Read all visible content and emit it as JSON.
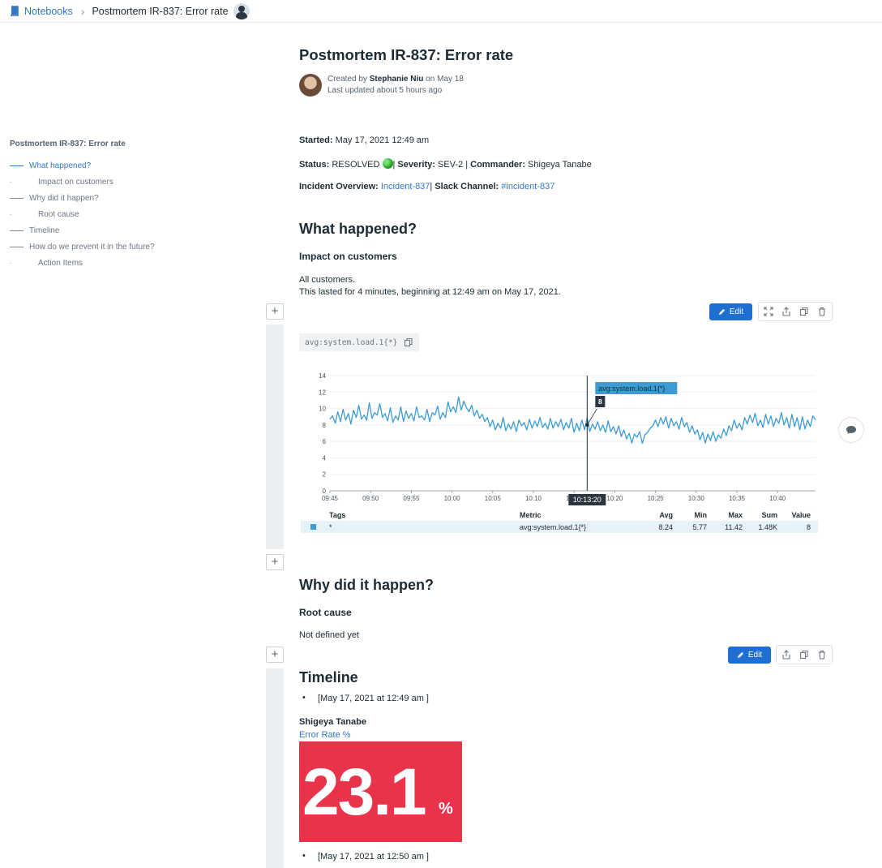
{
  "breadcrumb": {
    "root": "Notebooks",
    "current": "Postmortem IR-837: Error rate"
  },
  "toc": {
    "title": "Postmortem IR-837: Error rate",
    "items": [
      {
        "label": "What happened?"
      },
      {
        "label": "Impact on customers"
      },
      {
        "label": "Why did it happen?"
      },
      {
        "label": "Root cause"
      },
      {
        "label": "Timeline"
      },
      {
        "label": "How do we prevent it in the future?"
      },
      {
        "label": "Action Items"
      }
    ]
  },
  "doc": {
    "title": "Postmortem IR-837: Error rate",
    "created_prefix": "Created by",
    "author": "Stephanie Niu",
    "created_suffix": "on May 18",
    "updated": "Last updated about 5 hours ago"
  },
  "meta": {
    "started_label": "Started:",
    "started_value": "May 17, 2021 12:49 am",
    "status_label": "Status:",
    "status_value": "RESOLVED",
    "severity_label": "Severity:",
    "severity_value": "SEV-2",
    "commander_label": "Commander:",
    "commander_value": "Shigeya Tanabe",
    "overview_label": "Incident Overview:",
    "overview_link": "Incident-837",
    "slack_label": "Slack Channel:",
    "slack_link": "#incident-837",
    "separator": "|"
  },
  "sections": {
    "what_happened": "What happened?",
    "impact": "Impact on customers",
    "impact_line1": "All customers.",
    "impact_line2": "This lasted for 4 minutes, beginning at 12:49 am on May 17, 2021.",
    "why": "Why did it happen?",
    "root_cause": "Root cause",
    "root_cause_text": "Not defined yet",
    "timeline": "Timeline",
    "timeline_1": "[May 17, 2021 at 12:49 am ]",
    "timeline_author": "Shigeya Tanabe",
    "timeline_2": "[May 17, 2021 at 12:50 am ]"
  },
  "cell_actions": {
    "edit": "Edit"
  },
  "query": "avg:system.load.1{*}",
  "chart_data": {
    "type": "line",
    "series": [
      {
        "name": "avg:system.load.1{*}",
        "color": "#3d9bd4",
        "values": [
          8.7,
          9.1,
          8.2,
          9.6,
          8.4,
          9.9,
          8.6,
          9.4,
          8.1,
          9.8,
          8.9,
          10.4,
          8.7,
          9.2,
          8.6,
          10.7,
          8.8,
          9.5,
          9.2,
          10.6,
          8.9,
          9.4,
          8.5,
          10.1,
          8.3,
          9.1,
          8.6,
          10.2,
          8.4,
          9.7,
          8.8,
          9.4,
          8.5,
          10.2,
          8.9,
          9.1,
          8.6,
          9.9,
          8.4,
          9.5,
          9.2,
          10.3,
          8.7,
          9.5,
          8.9,
          10.8,
          9.6,
          10.2,
          9.5,
          11.4,
          9.8,
          10.9,
          10.1,
          9.6,
          10.4,
          9.1,
          9.8,
          8.8,
          9.3,
          8.4,
          8.9,
          7.8,
          8.6,
          7.4,
          8.2,
          7.6,
          8.9,
          7.3,
          8.1,
          7.5,
          8.4,
          7.2,
          8.6,
          7.9,
          8.3,
          7.4,
          8.7,
          7.6,
          8.5,
          7.8,
          8.9,
          7.7,
          8.2,
          7.5,
          8.8,
          7.6,
          8.4,
          7.8,
          8.7,
          7.4,
          8.3,
          7.6,
          8.8,
          7.1,
          8.2,
          7.3,
          8.6,
          7.4,
          8.9,
          7.2,
          8.1,
          7.5,
          8.4,
          7.3,
          8.0,
          7.1,
          8.5,
          7.2,
          7.8,
          6.9,
          7.9,
          6.6,
          7.4,
          6.3,
          7.0,
          5.8,
          6.9,
          6.5,
          7.2,
          5.77,
          6.8,
          7.1,
          7.6,
          7.9,
          8.6,
          7.8,
          8.9,
          8.1,
          9.0,
          7.6,
          8.8,
          7.9,
          8.4,
          7.5,
          8.9,
          7.8,
          8.3,
          7.1,
          7.9,
          6.9,
          7.4,
          6.2,
          7.1,
          5.8,
          6.9,
          6.1,
          7.2,
          6.0,
          6.8,
          6.4,
          7.5,
          6.7,
          7.9,
          7.3,
          8.6,
          7.6,
          8.2,
          7.4,
          8.9,
          8.1,
          9.2,
          8.3,
          9.4,
          7.9,
          8.6,
          7.7,
          9.3,
          8.1,
          9.1,
          7.8,
          8.8,
          8.2,
          9.5,
          8.0,
          8.9,
          7.6,
          9.3,
          7.8,
          8.9,
          7.4,
          9.0,
          7.5,
          8.6,
          7.8,
          9.1,
          8.6
        ]
      }
    ],
    "x_ticks": [
      "09:45",
      "09:50",
      "09:55",
      "10:00",
      "10:05",
      "10:10",
      "10:15",
      "10:20",
      "10:25",
      "10:30",
      "10:35",
      "10:40"
    ],
    "y_ticks": [
      0,
      2,
      4,
      6,
      8,
      10,
      12,
      14
    ],
    "ylim": [
      0,
      14
    ],
    "grid": true,
    "hover": {
      "time_label": "10:13:20",
      "series_label": "avg:system.load.1{*}",
      "value_label": "8",
      "value": 8,
      "index": 98
    },
    "legend": {
      "headers": {
        "tags": "Tags",
        "metric": "Metric",
        "avg": "Avg",
        "min": "Min",
        "max": "Max",
        "sum": "Sum",
        "value": "Value"
      },
      "row": {
        "tags": "*",
        "metric": "avg:system.load.1{*}",
        "avg": "8.24",
        "min": "5.77",
        "max": "11.42",
        "sum": "1.48K",
        "value": "8"
      }
    }
  },
  "query_value": {
    "label": "Error Rate %",
    "value": "23.1",
    "unit": "%",
    "color": "#e8334a"
  },
  "colors": {
    "accent": "#1f6ed4",
    "link": "#3277c4",
    "series": "#3d9bd4"
  }
}
